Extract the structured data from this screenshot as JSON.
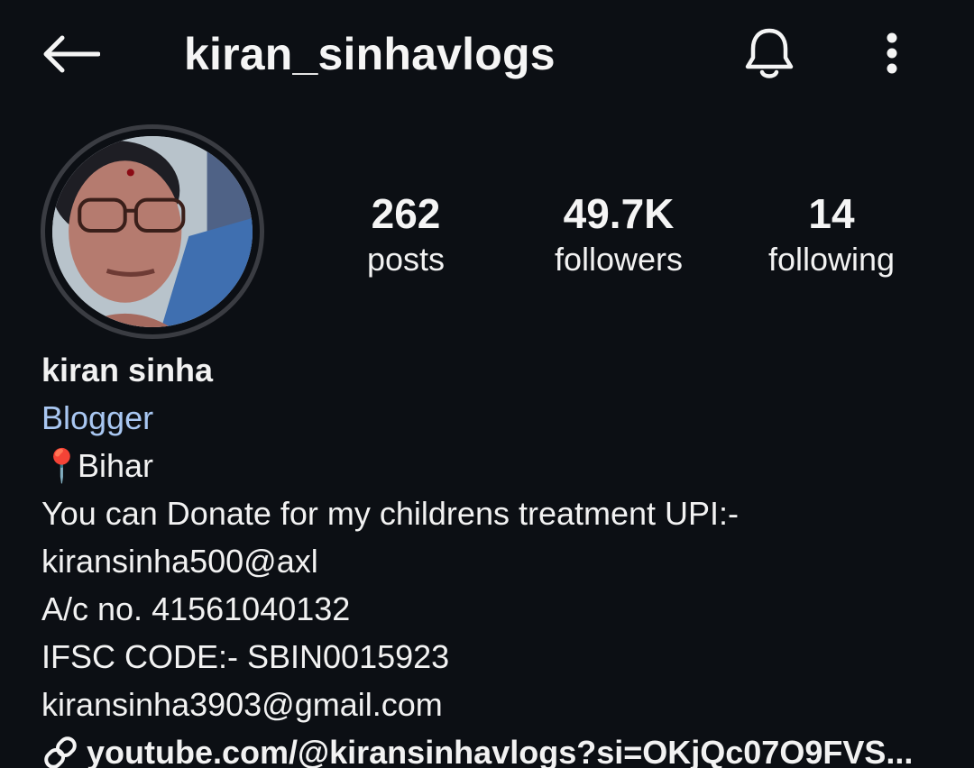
{
  "header": {
    "username": "kiran_sinhavlogs",
    "back_icon": "arrow-left-icon",
    "notification_icon": "bell-icon",
    "more_icon": "more-vertical-icon"
  },
  "stats": {
    "posts": {
      "value": "262",
      "label": "posts"
    },
    "followers": {
      "value": "49.7K",
      "label": "followers"
    },
    "following": {
      "value": "14",
      "label": "following"
    }
  },
  "bio": {
    "name": "kiran sinha",
    "category": "Blogger",
    "location_icon": "📍",
    "location": "Bihar",
    "lines": [
      "You can Donate for my childrens treatment UPI:-",
      "kiransinha500@axl",
      "A/c no. 41561040132",
      "IFSC CODE:- SBIN0015923",
      "kiransinha3903@gmail.com"
    ],
    "link": "youtube.com/@kiransinhavlogs?si=OKjQc07O9FVS...",
    "link_icon": "link-icon"
  },
  "colors": {
    "background": "#0c0f14",
    "text": "#f5f5f5",
    "category": "#a9c7f2",
    "avatar_ring": "#3a3c42"
  }
}
